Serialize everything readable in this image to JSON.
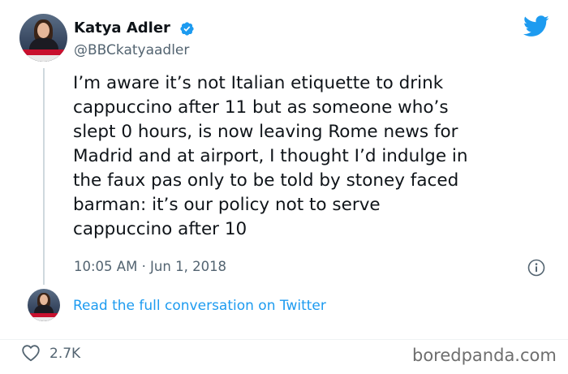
{
  "author": {
    "name": "Katya Adler",
    "handle": "@BBCkatyaadler",
    "verified": true
  },
  "tweet": {
    "text": "I’m aware it’s not Italian etiquette to drink\ncappuccino after 11 but as someone who’s\nslept 0 hours, is now leaving Rome news for\nMadrid and at airport, I thought I’d indulge in\nthe faux pas only to be told by stoney faced\nbarman: it’s our policy not to serve\ncappuccino after 10",
    "timestamp": "10:05 AM · Jun 1, 2018"
  },
  "footer": {
    "read_link": "Read the full conversation on Twitter",
    "likes": "2.7K"
  },
  "watermark": "boredpanda.com",
  "icons": [
    "verified-badge-icon",
    "twitter-bird-icon",
    "info-icon",
    "heart-icon"
  ],
  "colors": {
    "brand_blue": "#1d9bf0",
    "text": "#0f1419",
    "secondary_text": "#536471",
    "thread_line": "#cfd9de"
  }
}
